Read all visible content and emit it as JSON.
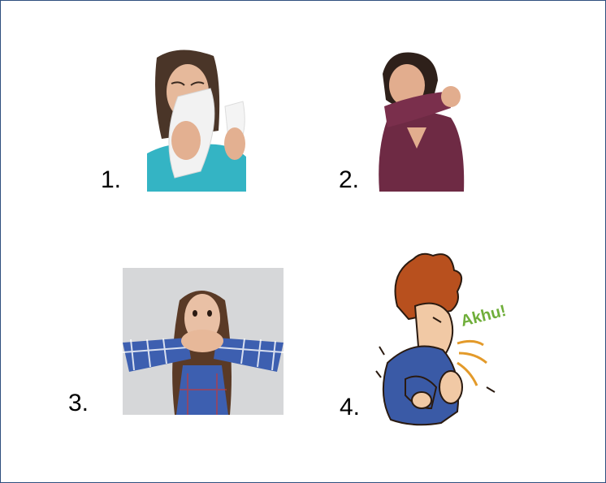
{
  "items": [
    {
      "number": "1.",
      "image": "woman-sneezing-into-tissue"
    },
    {
      "number": "2.",
      "image": "woman-coughing-into-elbow"
    },
    {
      "number": "3.",
      "image": "woman-covering-mouth-with-hands"
    },
    {
      "number": "4.",
      "image": "cartoon-man-coughing",
      "exclamation": "Akhu!"
    }
  ],
  "colors": {
    "border": "#2f4f7f",
    "tissue": "#f2f2f2",
    "teal_shirt": "#34b4c4",
    "maroon_shirt": "#6e2a44",
    "plaid_shirt": "#3d5fb0",
    "cartoon_hair": "#b8501e",
    "cartoon_shirt": "#3a5aa6",
    "cough_text": "#6fae3a"
  }
}
